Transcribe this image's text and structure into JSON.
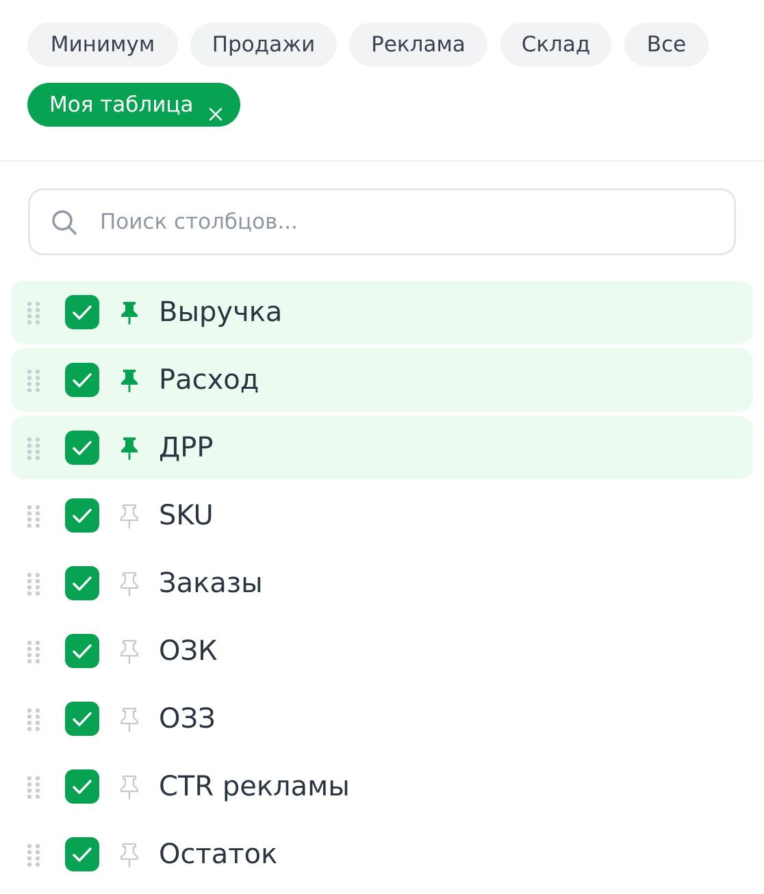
{
  "presets": {
    "items": [
      {
        "label": "Минимум"
      },
      {
        "label": "Продажи"
      },
      {
        "label": "Реклама"
      },
      {
        "label": "Склад"
      },
      {
        "label": "Все"
      }
    ],
    "active": {
      "label": "Моя таблица"
    }
  },
  "search": {
    "placeholder": "Поиск столбцов...",
    "value": ""
  },
  "columns": [
    {
      "label": "Выручка",
      "checked": true,
      "pinned": true
    },
    {
      "label": "Расход",
      "checked": true,
      "pinned": true
    },
    {
      "label": "ДРР",
      "checked": true,
      "pinned": true
    },
    {
      "label": "SKU",
      "checked": true,
      "pinned": false
    },
    {
      "label": "Заказы",
      "checked": true,
      "pinned": false
    },
    {
      "label": "ОЗК",
      "checked": true,
      "pinned": false
    },
    {
      "label": "ОЗЗ",
      "checked": true,
      "pinned": false
    },
    {
      "label": "CTR рекламы",
      "checked": true,
      "pinned": false
    },
    {
      "label": "Остаток",
      "checked": true,
      "pinned": false
    }
  ],
  "colors": {
    "accent": "#07a352",
    "pinned_row_bg": "#ebfbf0",
    "chip_bg": "#f2f3f5",
    "text": "#2b3441",
    "unpinned_icon": "#c4c9cf"
  }
}
